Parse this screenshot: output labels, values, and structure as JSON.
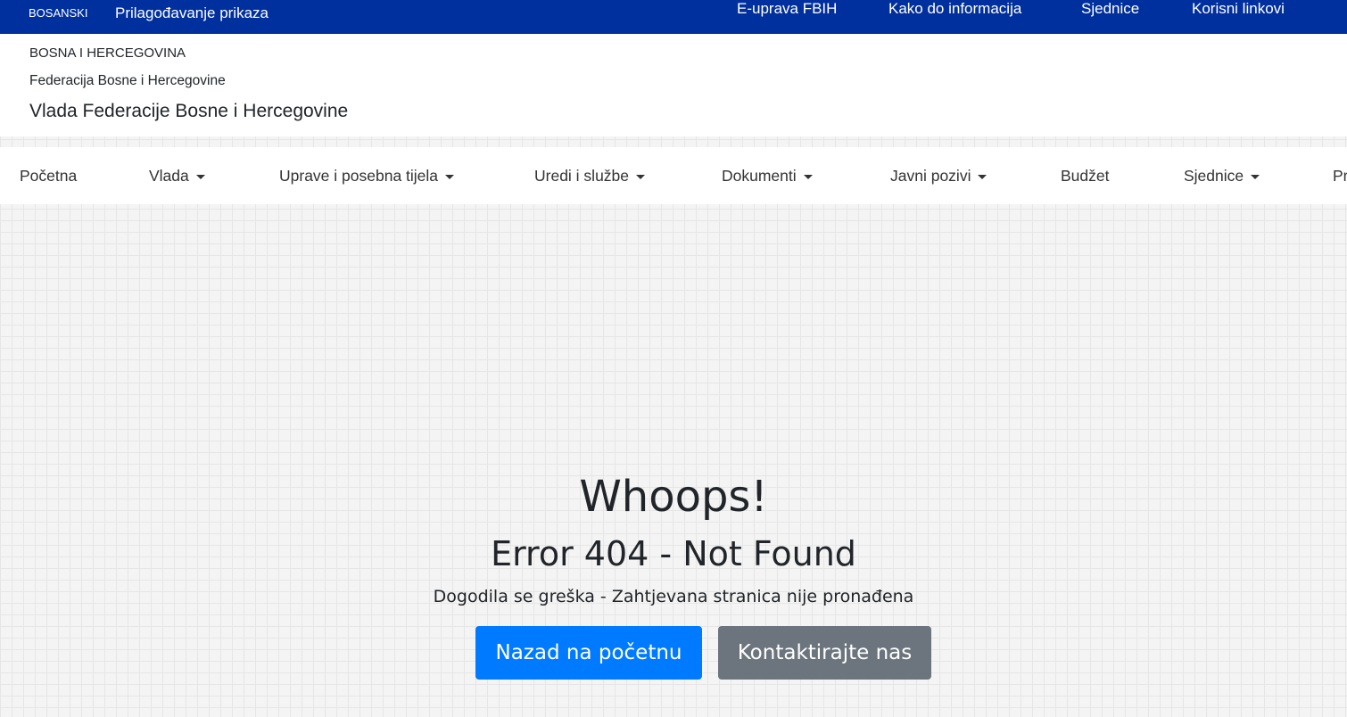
{
  "topbar": {
    "language": "BOSANSKI",
    "display_adjust": "Prilagođavanje prikaza",
    "links": [
      "E-uprava FBIH",
      "Kako do informacija",
      "Sjednice",
      "Korisni linkovi"
    ]
  },
  "header": {
    "country": "BOSNA I HERCEGOVINA",
    "entity": "Federacija Bosne i Hercegovine",
    "government": "Vlada Federacije Bosne i Hercegovine"
  },
  "nav": {
    "items": [
      {
        "label": "Početna",
        "dropdown": false
      },
      {
        "label": "Vlada",
        "dropdown": true
      },
      {
        "label": "Uprave i posebna tijela",
        "dropdown": true
      },
      {
        "label": "Uredi i službe",
        "dropdown": true
      },
      {
        "label": "Dokumenti",
        "dropdown": true
      },
      {
        "label": "Javni pozivi",
        "dropdown": true
      },
      {
        "label": "Budžet",
        "dropdown": false
      },
      {
        "label": "Sjednice",
        "dropdown": true
      },
      {
        "label": "Pr",
        "dropdown": false
      }
    ]
  },
  "error": {
    "title": "Whoops!",
    "code": "Error 404 - Not Found",
    "message": "Dogodila se greška - Zahtjevana stranica nije pronađena",
    "home_button": "Nazad na početnu",
    "contact_button": "Kontaktirajte nas"
  },
  "colors": {
    "topbar": "#002f9e",
    "primary_button": "#007bff",
    "secondary_button": "#6c757d"
  }
}
